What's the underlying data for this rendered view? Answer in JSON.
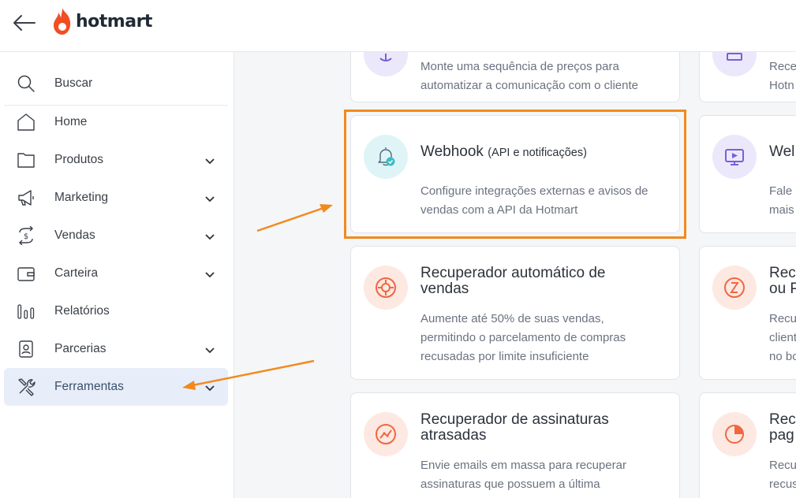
{
  "header": {
    "logo_text": "hotmart"
  },
  "sidebar": {
    "search_label": "Buscar",
    "items": [
      {
        "label": "Home"
      },
      {
        "label": "Produtos"
      },
      {
        "label": "Marketing"
      },
      {
        "label": "Vendas"
      },
      {
        "label": "Carteira"
      },
      {
        "label": "Relatórios"
      },
      {
        "label": "Parcerias"
      },
      {
        "label": "Ferramentas"
      }
    ]
  },
  "cards": {
    "top_left": {
      "desc1": "Monte uma sequência de preços para",
      "desc2": "automatizar a comunicação com o cliente"
    },
    "top_right": {
      "desc1": "Rece",
      "desc2": "Hotn"
    },
    "webhook": {
      "title": "Webhook",
      "title_small": "(API e notificações)",
      "desc1": "Configure integrações externas e avisos de",
      "desc2": "vendas com a API da Hotmart"
    },
    "webhook_right": {
      "title": "Wel",
      "desc1": "Fale",
      "desc2": "mais"
    },
    "recuperador": {
      "title1": "Recuperador automático de",
      "title2": "vendas",
      "desc1": "Aumente até 50% de suas vendas,",
      "desc2": "permitindo o parcelamento de compras",
      "desc3": "recusadas por limite insuficiente"
    },
    "recuperador_right": {
      "title1": "Rec",
      "title2": "ou P",
      "desc1": "Recu",
      "desc2": "client",
      "desc3": "no bo"
    },
    "assinaturas": {
      "title1": "Recuperador de assinaturas",
      "title2": "atrasadas",
      "desc1": "Envie emails em massa para recuperar",
      "desc2": "assinaturas que possuem a última"
    },
    "assinaturas_right": {
      "title1": "Rec",
      "title2": "pag",
      "desc1": "Recu",
      "desc2": "recus"
    }
  },
  "colors": {
    "accent_orange": "#f28a1d",
    "logo_flame": "#f04e23",
    "active_bg": "#e8eef9",
    "icon_orange_bg": "#fde8e2",
    "icon_orange": "#f0673f",
    "icon_teal_bg": "#dff4f7",
    "icon_purple_bg": "#ece8fb"
  }
}
